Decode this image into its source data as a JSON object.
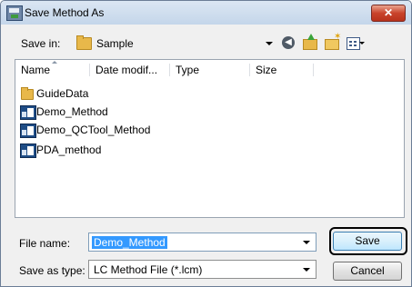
{
  "window": {
    "title": "Save Method As",
    "close_label": "✕"
  },
  "toolbar": {
    "save_in_label": "Save in:",
    "save_in_value": "Sample"
  },
  "file_list": {
    "columns": [
      "Name",
      "Date modif...",
      "Type",
      "Size"
    ],
    "items": [
      {
        "label": "GuideData",
        "icon": "folder-icon"
      },
      {
        "label": "Demo_Method",
        "icon": "method-file-icon"
      },
      {
        "label": "Demo_QCTool_Method",
        "icon": "method-file-icon"
      },
      {
        "label": "PDA_method",
        "icon": "method-file-icon"
      }
    ]
  },
  "file_name": {
    "label": "File name:",
    "value": "Demo_Method"
  },
  "save_as_type": {
    "label": "Save as type:",
    "value": "LC Method File (*.lcm)"
  },
  "buttons": {
    "save": "Save",
    "cancel": "Cancel"
  },
  "colors": {
    "selection": "#3399ff",
    "accent_border": "#3c7fb1"
  }
}
